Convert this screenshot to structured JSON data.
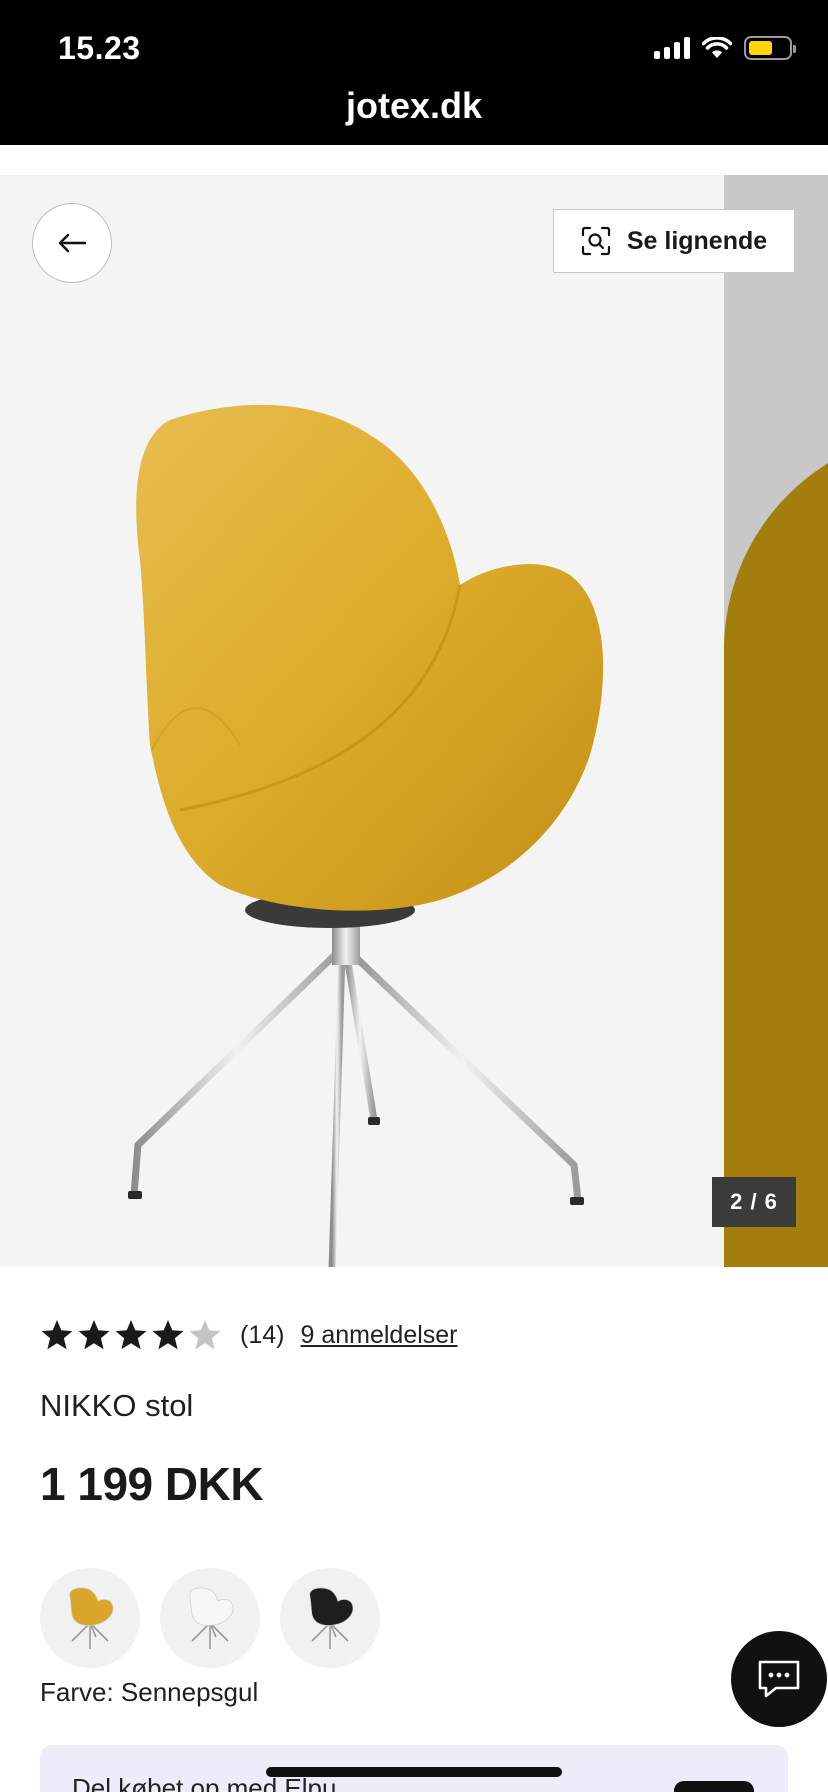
{
  "status_bar": {
    "time": "15.23"
  },
  "browser": {
    "url": "jotex.dk"
  },
  "gallery": {
    "similar_label": "Se lignende",
    "counter": "2 / 6",
    "product_color": "#dcab28",
    "next_slide_color": "#a37e0c"
  },
  "rating": {
    "value": 4,
    "max": 5,
    "count_label": "(14)",
    "reviews_link": "9 anmeldelser"
  },
  "product": {
    "name": "NIKKO stol",
    "price": "1 199 DKK"
  },
  "color_options": [
    {
      "name": "Sennepsgul",
      "hex": "#d9a52a"
    },
    {
      "name": "Hvid",
      "hex": "#f7f7f7"
    },
    {
      "name": "Sort",
      "hex": "#1e1e1e"
    }
  ],
  "color_selection": {
    "label": "Farve: Sennepsgul"
  },
  "promo": {
    "text": "Del købet op med Elpu"
  }
}
